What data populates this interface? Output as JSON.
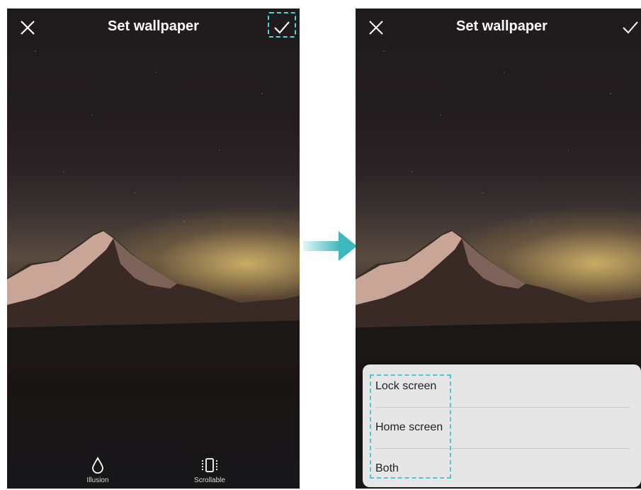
{
  "left_screen": {
    "title": "Set wallpaper",
    "close_icon": "close-icon",
    "confirm_icon": "checkmark-icon",
    "options": [
      {
        "label": "Illusion",
        "icon": "droplet-icon"
      },
      {
        "label": "Scrollable",
        "icon": "scrollable-icon"
      }
    ]
  },
  "right_screen": {
    "title": "Set wallpaper",
    "close_icon": "close-icon",
    "confirm_icon": "checkmark-icon",
    "menu": {
      "items": [
        {
          "label": "Lock screen"
        },
        {
          "label": "Home screen"
        },
        {
          "label": "Both"
        }
      ]
    }
  },
  "colors": {
    "highlight": "#4fd6d6",
    "arrow": "#3fb8bd",
    "menu_background": "#e6e6e6"
  }
}
